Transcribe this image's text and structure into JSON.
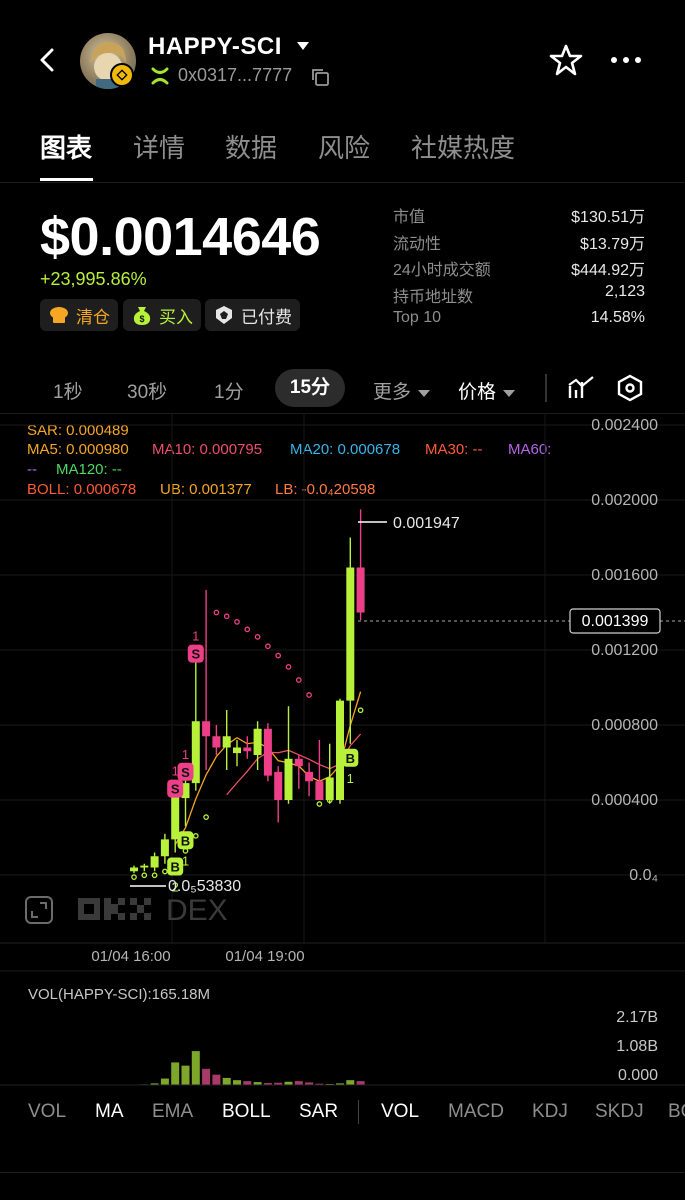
{
  "header": {
    "token_name": "HAPPY-SCI",
    "address": "0x0317...7777"
  },
  "tabs": [
    "图表",
    "详情",
    "数据",
    "风险",
    "社媒热度"
  ],
  "price": {
    "value": "$0.0014646",
    "change": "+23,995.86%"
  },
  "actions": [
    {
      "label": "清仓",
      "icon": "chef-hat-icon"
    },
    {
      "label": "买入",
      "icon": "money-bag-icon"
    },
    {
      "label": "已付费",
      "icon": "lion-icon"
    }
  ],
  "stats": [
    {
      "label": "市值",
      "value": "$130.51万"
    },
    {
      "label": "流动性",
      "value": "$13.79万"
    },
    {
      "label": "24小时成交额",
      "value": "$444.92万"
    },
    {
      "label": "持币地址数",
      "value": "2,123"
    },
    {
      "label": "Top 10",
      "value": "14.58%"
    }
  ],
  "intervals": {
    "i1s": "1秒",
    "i30s": "30秒",
    "i1m": "1分",
    "i15m": "15分",
    "more": "更多",
    "price": "价格"
  },
  "indicators": {
    "sar": "SAR: 0.000489",
    "ma5": "MA5: 0.000980",
    "ma10": "MA10: 0.000795",
    "ma20": "MA20: 0.000678",
    "ma30": "MA30: --",
    "ma60": "MA60:",
    "ma60_value": "--",
    "ma120": "MA120: --",
    "boll": "BOLL: 0.000678",
    "ub": "UB: 0.001377",
    "lb": "LB: -0.0₄20598"
  },
  "chart_data": {
    "type": "candlestick",
    "y_ticks": [
      "0.002400",
      "0.002000",
      "0.001600",
      "0.001200",
      "0.000800",
      "0.000400",
      "0.0₄"
    ],
    "x_ticks": [
      "01/04 16:00",
      "01/04 19:00"
    ],
    "current_price_label": "0.001399",
    "high_label": "0.001947",
    "low_label": "0.0₅53830",
    "watermark": "DEX",
    "ylim": [
      0,
      0.0024
    ],
    "candles": [
      {
        "o": 2e-05,
        "h": 5e-05,
        "l": 1e-05,
        "c": 4e-05
      },
      {
        "o": 4e-05,
        "h": 6e-05,
        "l": 2e-05,
        "c": 5e-05
      },
      {
        "o": 4e-05,
        "h": 0.00012,
        "l": 2e-05,
        "c": 0.0001
      },
      {
        "o": 0.0001,
        "h": 0.00022,
        "l": 6e-05,
        "c": 0.00019
      },
      {
        "o": 0.00019,
        "h": 0.00045,
        "l": 0.00012,
        "c": 0.00043
      },
      {
        "o": 0.00041,
        "h": 0.00054,
        "l": 0.00026,
        "c": 0.00049
      },
      {
        "o": 0.00049,
        "h": 0.00117,
        "l": 0.00045,
        "c": 0.00082
      },
      {
        "o": 0.00082,
        "h": 0.00152,
        "l": 0.00056,
        "c": 0.00074
      },
      {
        "o": 0.00074,
        "h": 0.0008,
        "l": 0.00064,
        "c": 0.00068
      },
      {
        "o": 0.00068,
        "h": 0.00088,
        "l": 0.00056,
        "c": 0.00074
      },
      {
        "o": 0.00065,
        "h": 0.00072,
        "l": 0.00058,
        "c": 0.00068
      },
      {
        "o": 0.00068,
        "h": 0.00074,
        "l": 0.00062,
        "c": 0.00066
      },
      {
        "o": 0.00064,
        "h": 0.00082,
        "l": 0.00056,
        "c": 0.00078
      },
      {
        "o": 0.00078,
        "h": 0.00081,
        "l": 0.0005,
        "c": 0.00053
      },
      {
        "o": 0.00055,
        "h": 0.00058,
        "l": 0.00028,
        "c": 0.0004
      },
      {
        "o": 0.0004,
        "h": 0.0009,
        "l": 0.00038,
        "c": 0.00062
      },
      {
        "o": 0.00062,
        "h": 0.00064,
        "l": 0.00046,
        "c": 0.00058
      },
      {
        "o": 0.00055,
        "h": 0.0006,
        "l": 0.00042,
        "c": 0.0005
      },
      {
        "o": 0.0005,
        "h": 0.00072,
        "l": 0.0004,
        "c": 0.0004
      },
      {
        "o": 0.0004,
        "h": 0.0007,
        "l": 0.00038,
        "c": 0.00052
      },
      {
        "o": 0.0004,
        "h": 0.00094,
        "l": 0.00038,
        "c": 0.00093
      },
      {
        "o": 0.00093,
        "h": 0.0018,
        "l": 0.0007,
        "c": 0.00164
      },
      {
        "o": 0.00164,
        "h": 0.00195,
        "l": 0.00136,
        "c": 0.0014
      }
    ],
    "markers": [
      {
        "candle": 6,
        "type": "S"
      },
      {
        "candle": 5,
        "type": "S"
      },
      {
        "candle": 4,
        "type": "S"
      },
      {
        "candle": 5,
        "type": "B"
      },
      {
        "candle": 4,
        "type": "B"
      },
      {
        "candle": 21,
        "type": "B"
      }
    ],
    "marker_counts": [
      "1",
      "1",
      "1",
      "1",
      "2",
      "1"
    ],
    "volume": {
      "label": "VOL(HAPPY-SCI):165.18M",
      "y_ticks": [
        "2.17B",
        "1.08B",
        "0.000"
      ]
    }
  },
  "bottom_tabs": [
    "VOL",
    "MA",
    "EMA",
    "BOLL",
    "SAR",
    "VOL",
    "MACD",
    "KDJ",
    "SKDJ",
    "BO"
  ],
  "colors": {
    "up": "#b8f13a",
    "down": "#ec3f87",
    "ma5": "#f5a623",
    "ma10": "#ee4f6a",
    "ma20": "#39b4e8",
    "ma30": "#ff5a36",
    "ma60": "#b366e6",
    "ma120": "#4cd964",
    "boll": "#ff5a36",
    "ub": "#f5a623",
    "lb": "#ff7b42",
    "sar_dots": "#b8f13a"
  }
}
